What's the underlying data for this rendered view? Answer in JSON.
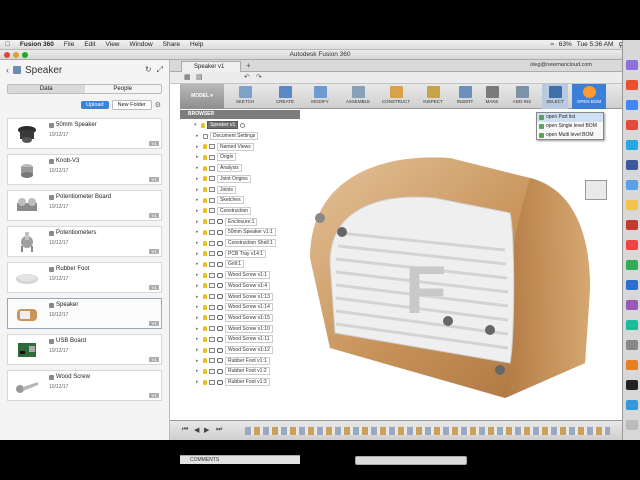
{
  "menubar": {
    "app": "Fusion 360",
    "items": [
      "File",
      "Edit",
      "View",
      "Window",
      "Share",
      "Help"
    ],
    "battery": "63%",
    "clock": "Tue 5:36 AM"
  },
  "window_title": "Autodesk Fusion 360",
  "data_panel": {
    "project": "Speaker",
    "tabs": [
      "Data",
      "People"
    ],
    "upload_label": "Upload",
    "new_folder_label": "New Folder",
    "files": [
      {
        "name": "50mm Speaker",
        "date": "10/12/17",
        "version": "V1"
      },
      {
        "name": "Knob-V3",
        "date": "10/12/17",
        "version": "V1"
      },
      {
        "name": "Potentiometer Board",
        "date": "10/12/17",
        "version": "V1"
      },
      {
        "name": "Potentiometers",
        "date": "10/12/17",
        "version": "V1"
      },
      {
        "name": "Rubber Foot",
        "date": "10/12/17",
        "version": "V1"
      },
      {
        "name": "Speaker",
        "date": "10/12/17",
        "version": "V1"
      },
      {
        "name": "USB Board",
        "date": "10/12/17",
        "version": "V1"
      },
      {
        "name": "Wood Screw",
        "date": "10/12/17",
        "version": "V1"
      }
    ]
  },
  "doc_tab": {
    "label": "Speaker v1",
    "user": "oleg@newmancloud.com"
  },
  "toolbar": {
    "model_label": "MODEL",
    "groups": [
      "SKETCH",
      "CREATE",
      "MODIFY",
      "ASSEMBLE",
      "CONSTRUCT",
      "INSPECT",
      "INSERT",
      "MAKE",
      "ADD-INS",
      "SELECT",
      "OPEN BOM"
    ]
  },
  "bom_menu": {
    "items": [
      "open Part list",
      "open Single level BOM",
      "open Multi level BOM"
    ]
  },
  "browser": {
    "header": "BROWSER",
    "root": "Speaker v1",
    "rows": [
      "Document Settings",
      "Named Views",
      "Origin",
      "Analysis",
      "Joint Origins",
      "Joints",
      "Sketches",
      "Construction",
      "Enclosure:1",
      "50mm Speaker v1:1",
      "Construction Shell:1",
      "PCB Tray v14:1",
      "Grill:1",
      "Wood Screw v1:1",
      "Wood Screw v1:4",
      "Wood Screw v1:13",
      "Wood Screw v1:14",
      "Wood Screw v1:15",
      "Wood Screw v1:10",
      "Wood Screw v1:11",
      "Wood Screw v1:12",
      "Rubber Foot v1:1",
      "Rubber Foot v1:2",
      "Rubber Foot v1:3"
    ]
  },
  "comments_label": "COMMENTS",
  "colors": {
    "accent": "#3b83d8",
    "wood": "#c9935a",
    "grill": "#efefef"
  }
}
